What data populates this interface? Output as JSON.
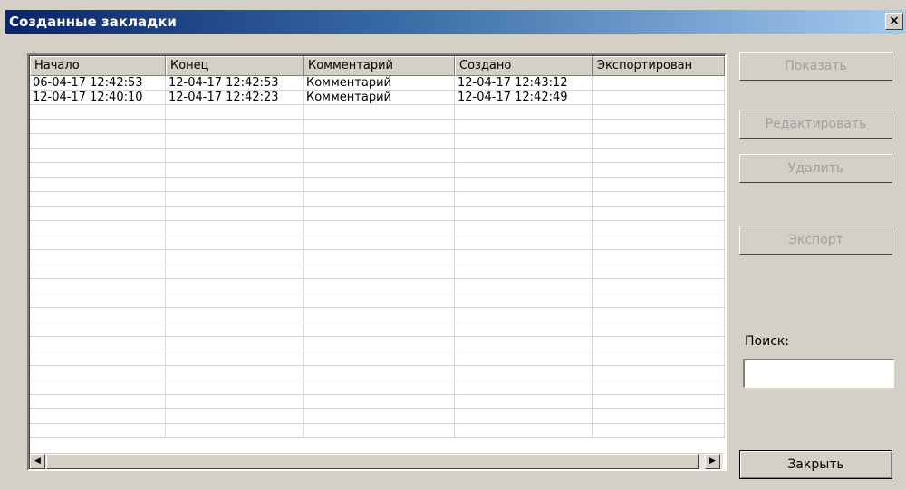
{
  "window": {
    "title": "Созданные закладки",
    "close_glyph": "×"
  },
  "table": {
    "columns": [
      "Начало",
      "Конец",
      "Комментарий",
      "Создано",
      "Экспортирован"
    ],
    "rows": [
      [
        "06-04-17 12:42:53",
        "12-04-17 12:42:53",
        "Комментарий",
        "12-04-17 12:43:12",
        ""
      ],
      [
        "12-04-17 12:40:10",
        "12-04-17 12:42:23",
        "Комментарий",
        "12-04-17 12:42:49",
        ""
      ]
    ]
  },
  "scrollbar": {
    "left_arrow": "◀",
    "right_arrow": "▶"
  },
  "buttons": {
    "show": "Показать",
    "edit": "Редактировать",
    "delete": "Удалить",
    "export": "Экспорт",
    "close": "Закрыть"
  },
  "search": {
    "label": "Поиск:",
    "value": ""
  }
}
